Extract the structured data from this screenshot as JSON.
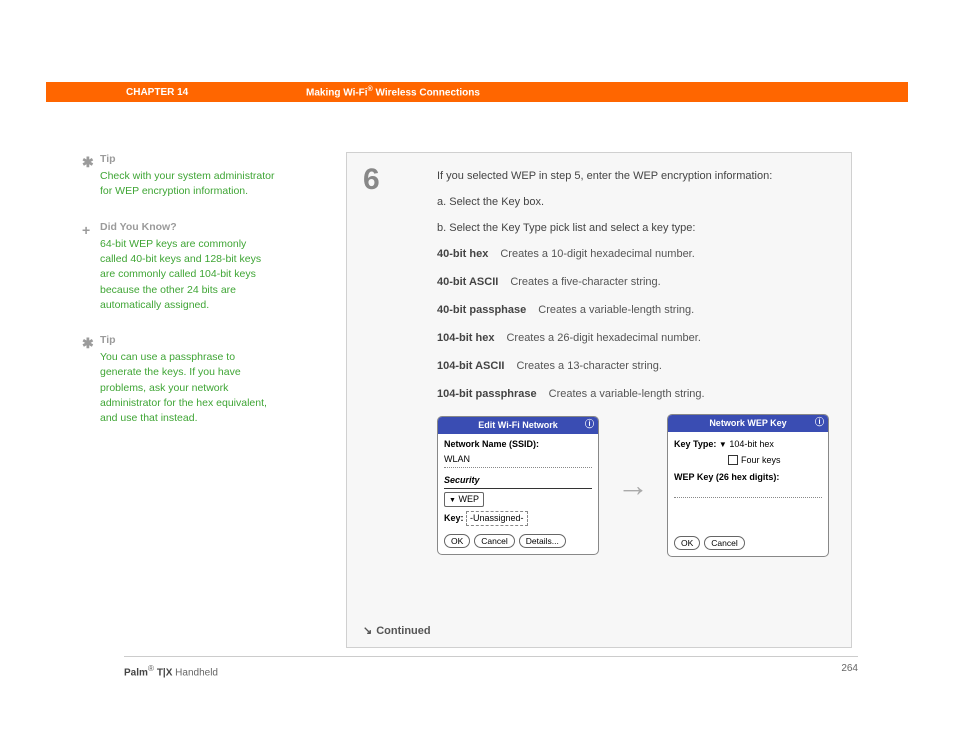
{
  "header": {
    "chapter": "CHAPTER 14",
    "title_prefix": "Making Wi-Fi",
    "title_suffix": " Wireless Connections",
    "reg": "®"
  },
  "sidebar": [
    {
      "icon": "✱",
      "label": "Tip",
      "text": "Check with your system administrator for WEP encryption information."
    },
    {
      "icon": "+",
      "label": "Did You Know?",
      "text": "64-bit WEP keys are commonly called 40-bit keys and 128-bit keys are commonly called 104-bit keys because the other 24 bits are automatically assigned."
    },
    {
      "icon": "✱",
      "label": "Tip",
      "text": "You can use a passphrase to generate the keys. If you have problems, ask your network administrator for the hex equivalent, and use that instead."
    }
  ],
  "step": {
    "number": "6",
    "intro": "If you selected WEP in step 5, enter the WEP encryption information:",
    "sub_a": "a.  Select the Key box.",
    "sub_b": "b.  Select the Key Type pick list and select a key type:",
    "types": [
      {
        "name": "40-bit hex",
        "desc": "Creates a 10-digit hexadecimal number."
      },
      {
        "name": "40-bit ASCII",
        "desc": "Creates a five-character string."
      },
      {
        "name": "40-bit passphase",
        "desc": "Creates a variable-length string."
      },
      {
        "name": "104-bit hex",
        "desc": "Creates a 26-digit hexadecimal number."
      },
      {
        "name": "104-bit ASCII",
        "desc": "Creates a 13-character string."
      },
      {
        "name": "104-bit passphrase",
        "desc": "Creates a variable-length string."
      }
    ],
    "continued": "Continued"
  },
  "palm1": {
    "title": "Edit Wi-Fi Network",
    "ssid_label": "Network Name (SSID):",
    "ssid_value": "WLAN",
    "security_heading": "Security",
    "security_value": "WEP",
    "key_label": "Key:",
    "key_value": "-Unassigned-",
    "btn_ok": "OK",
    "btn_cancel": "Cancel",
    "btn_details": "Details..."
  },
  "palm2": {
    "title": "Network WEP Key",
    "keytype_label": "Key Type:",
    "keytype_value": "104-bit hex",
    "fourkeys": "Four keys",
    "wep_label": "WEP Key (26 hex digits):",
    "btn_ok": "OK",
    "btn_cancel": "Cancel"
  },
  "footer": {
    "product_bold": "Palm",
    "product_reg": "®",
    "product_model": " T|X",
    "product_tail": " Handheld",
    "page": "264"
  }
}
